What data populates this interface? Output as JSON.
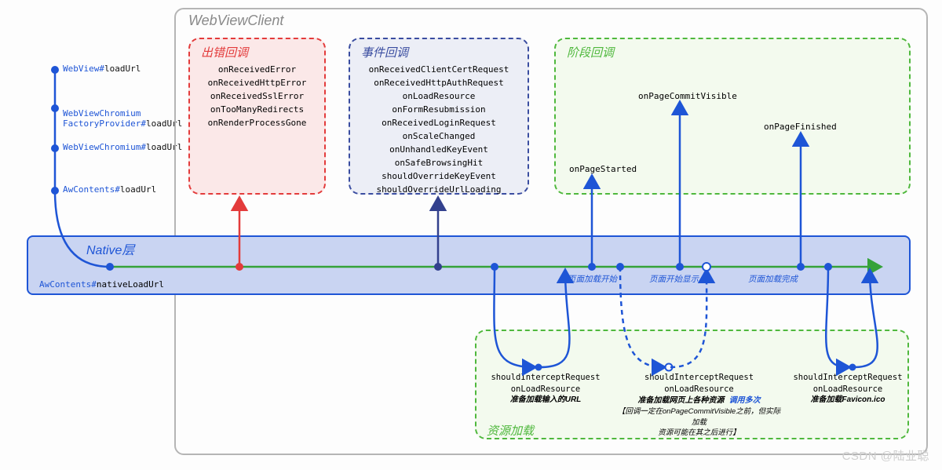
{
  "outer": {
    "title": "WebViewClient"
  },
  "chain": [
    {
      "classPart": "WebView#",
      "method": "loadUrl"
    },
    {
      "classPart": "WebViewChromium\nFactoryProvider#",
      "method": "loadUrl"
    },
    {
      "classPart": "WebViewChromium#",
      "method": "loadUrl"
    },
    {
      "classPart": "AwContents#",
      "method": "loadUrl"
    }
  ],
  "errorBox": {
    "title": "出错回调",
    "items": [
      "onReceivedError",
      "onReceivedHttpError",
      "onReceivedSslError",
      "onTooManyRedirects",
      "onRenderProcessGone"
    ]
  },
  "eventBox": {
    "title": "事件回调",
    "items": [
      "onReceivedClientCertRequest",
      "onReceivedHttpAuthRequest",
      "onLoadResource",
      "onFormResubmission",
      "onReceivedLoginRequest",
      "onScaleChanged",
      "onUnhandledKeyEvent",
      "onSafeBrowsingHit",
      "shouldOverrideKeyEvent",
      "shouldOverrideUrlLoading"
    ]
  },
  "stageBox": {
    "title": "阶段回调",
    "onPageStarted": "onPageStarted",
    "onPageCommitVisible": "onPageCommitVisible",
    "onPageFinished": "onPageFinished"
  },
  "native": {
    "title": "Native层",
    "call_class": "AwContents#",
    "call_method": "nativeLoadUrl"
  },
  "timeline": {
    "label_start": "页面加载开始",
    "label_show": "页面开始显示",
    "label_done": "页面加载完成"
  },
  "resource": {
    "title": "资源加载",
    "cols": [
      {
        "lines": [
          "shouldInterceptRequest",
          "onLoadResource"
        ],
        "zh_bold": "准备加载输入的URL",
        "zh_note": ""
      },
      {
        "lines": [
          "shouldInterceptRequest",
          "onLoadResource"
        ],
        "zh_bold": "准备加载网页上各种资源",
        "zh_bold_extra": "调用多次",
        "zh_note": "【回调一定在onPageCommitVisible之前，但实际加载\n资源可能在其之后进行】"
      },
      {
        "lines": [
          "shouldInterceptRequest",
          "onLoadResource"
        ],
        "zh_bold": "准备加载Favicon.ico",
        "zh_note": ""
      }
    ]
  },
  "watermark": "CSDN @陆业聪"
}
